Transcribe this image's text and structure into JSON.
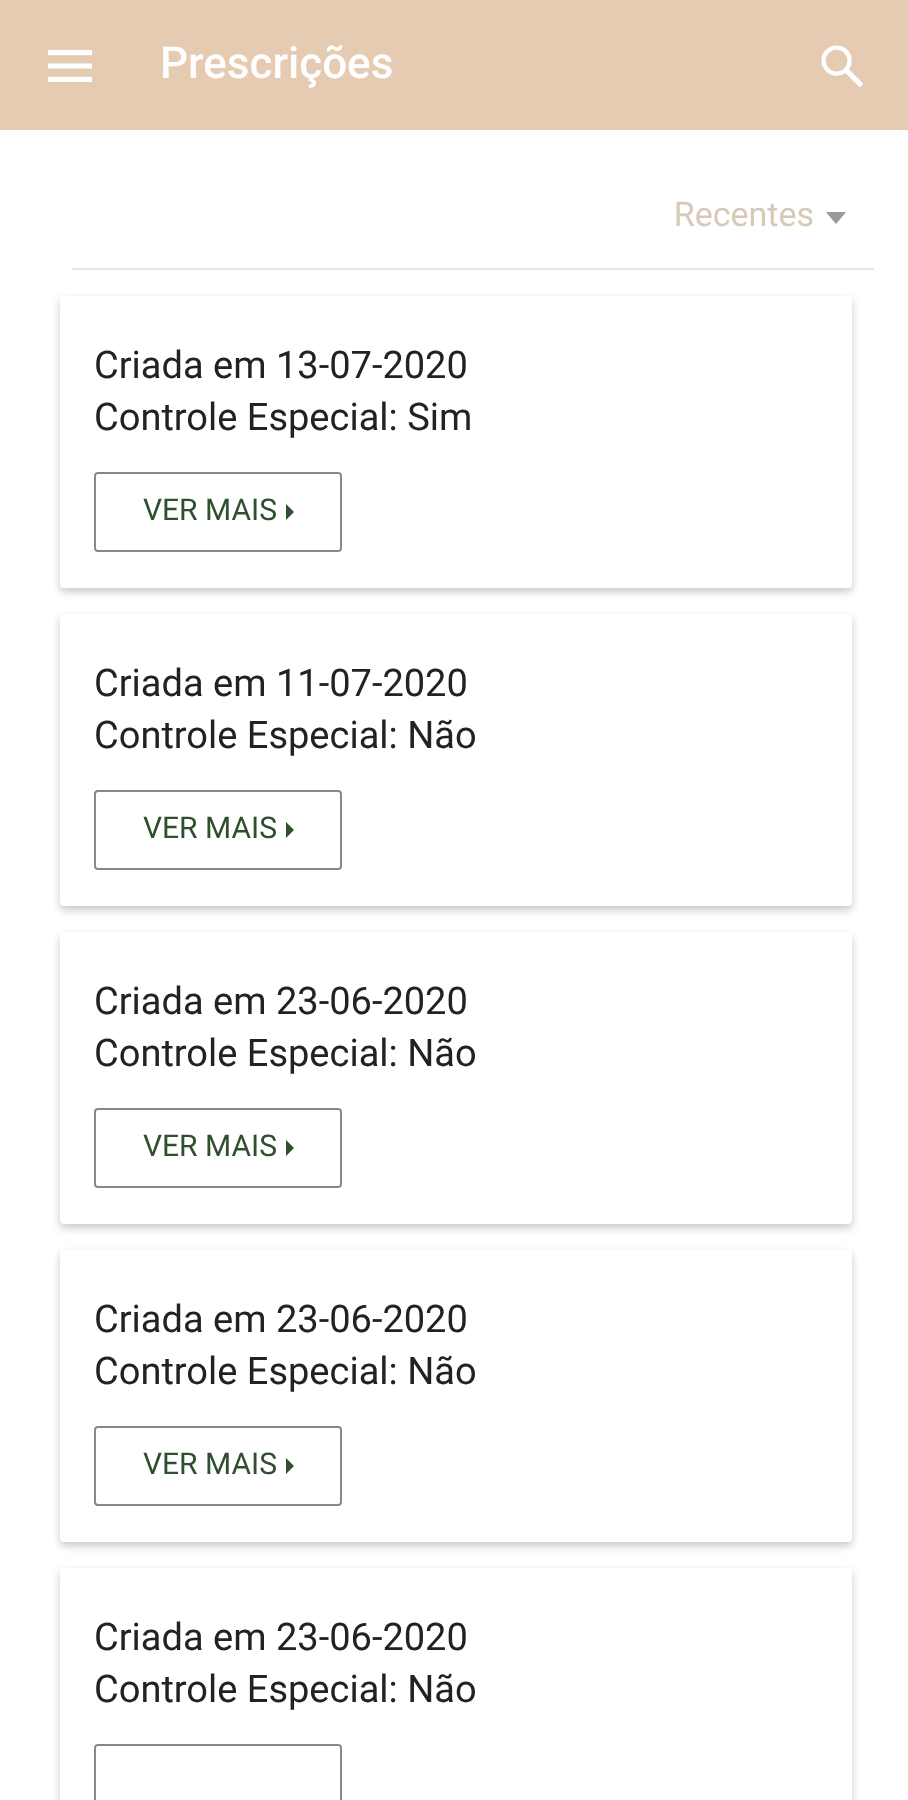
{
  "app_bar": {
    "title": "Prescrições"
  },
  "sort": {
    "label": "Recentes"
  },
  "cards": [
    {
      "created": "Criada em 13-07-2020",
      "special": "Controle Especial: Sim",
      "button": "VER MAIS"
    },
    {
      "created": "Criada em 11-07-2020",
      "special": "Controle Especial: Não",
      "button": "VER MAIS"
    },
    {
      "created": "Criada em 23-06-2020",
      "special": "Controle Especial: Não",
      "button": "VER MAIS"
    },
    {
      "created": "Criada em 23-06-2020",
      "special": "Controle Especial: Não",
      "button": "VER MAIS"
    },
    {
      "created": "Criada em 23-06-2020",
      "special": "Controle Especial: Não"
    }
  ]
}
